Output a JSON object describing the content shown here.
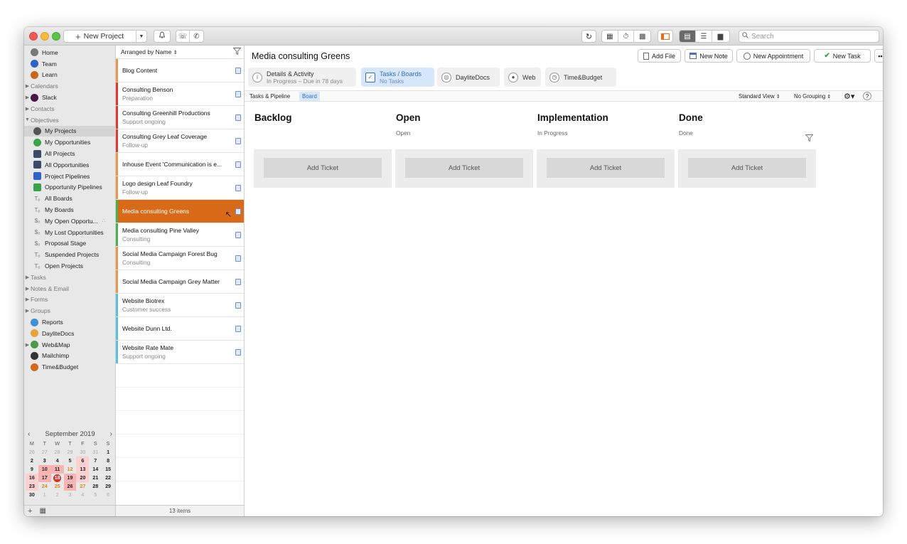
{
  "toolbar": {
    "new_project_label": "New Project",
    "search_placeholder": "Search"
  },
  "sidebar": {
    "items": [
      {
        "label": "Home",
        "icon": "house-icon",
        "color": "#777777"
      },
      {
        "label": "Team",
        "icon": "team-icon",
        "color": "#2d63c7"
      },
      {
        "label": "Learn",
        "icon": "books-icon",
        "color": "#c6671c"
      },
      {
        "label": "Calendars",
        "section": true
      },
      {
        "label": "Slack",
        "icon": "slack-icon",
        "color": "#4a154b",
        "expandable": true
      },
      {
        "label": "Contacts",
        "section": true
      },
      {
        "label": "Objectives",
        "section": true,
        "expanded": true
      },
      {
        "label": "My Projects",
        "icon": "pin-icon",
        "color": "#555555",
        "selected": true
      },
      {
        "label": "My Opportunities",
        "icon": "dollar-icon",
        "color": "#3aa24a"
      },
      {
        "label": "All Projects",
        "icon": "projects-icon",
        "color": "#3c4a6a"
      },
      {
        "label": "All Opportunities",
        "icon": "opportunities-icon",
        "color": "#3c4a6a"
      },
      {
        "label": "Project Pipelines",
        "icon": "pipeline-icon",
        "color": "#2d63c7"
      },
      {
        "label": "Opportunity Pipelines",
        "icon": "pipeline-icon",
        "color": "#3aa24a"
      },
      {
        "label": "All Boards",
        "icon": "board-icon",
        "color": "#888888"
      },
      {
        "label": "My Boards",
        "icon": "board-icon",
        "color": "#888888"
      },
      {
        "label": "My Open Opportu...",
        "icon": "filter-dollar-icon",
        "color": "#888888",
        "shared": true
      },
      {
        "label": "My Lost Opportunities",
        "icon": "filter-dollar-icon",
        "color": "#888888"
      },
      {
        "label": "Proposal Stage",
        "icon": "filter-dollar-icon",
        "color": "#888888"
      },
      {
        "label": "Suspended Projects",
        "icon": "board-icon",
        "color": "#888888"
      },
      {
        "label": "Open Projects",
        "icon": "board-icon",
        "color": "#888888"
      },
      {
        "label": "Tasks",
        "section": true
      },
      {
        "label": "Notes & Email",
        "section": true
      },
      {
        "label": "Forms",
        "section": true
      },
      {
        "label": "Groups",
        "section": true
      },
      {
        "label": "Reports",
        "icon": "reports-icon",
        "color": "#3f8fd6"
      },
      {
        "label": "DayliteDocs",
        "icon": "dayliteDocs-icon",
        "color": "#e8a33a"
      },
      {
        "label": "Web&Map",
        "icon": "globe-icon",
        "color": "#4a9a4a",
        "expandable": true
      },
      {
        "label": "Mailchimp",
        "icon": "mailchimp-icon",
        "color": "#333333"
      },
      {
        "label": "Time&Budget",
        "icon": "time-budget-icon",
        "color": "#d2691e"
      }
    ]
  },
  "calendar": {
    "month": "September 2019",
    "dow": [
      "M",
      "T",
      "W",
      "T",
      "F",
      "S",
      "S"
    ],
    "days": [
      {
        "d": "26",
        "c": "dim"
      },
      {
        "d": "27",
        "c": "dim"
      },
      {
        "d": "28",
        "c": "dim"
      },
      {
        "d": "29",
        "c": "dim"
      },
      {
        "d": "30",
        "c": "dim"
      },
      {
        "d": "31",
        "c": "dim"
      },
      {
        "d": "1",
        "c": ""
      },
      {
        "d": "2",
        "c": ""
      },
      {
        "d": "3",
        "c": ""
      },
      {
        "d": "4",
        "c": ""
      },
      {
        "d": "5",
        "c": ""
      },
      {
        "d": "6",
        "c": "r1"
      },
      {
        "d": "7",
        "c": ""
      },
      {
        "d": "8",
        "c": ""
      },
      {
        "d": "9",
        "c": ""
      },
      {
        "d": "10",
        "c": "r2"
      },
      {
        "d": "11",
        "c": "r2"
      },
      {
        "d": "12",
        "c": "or"
      },
      {
        "d": "13",
        "c": "r1"
      },
      {
        "d": "14",
        "c": ""
      },
      {
        "d": "15",
        "c": ""
      },
      {
        "d": "16",
        "c": "r1"
      },
      {
        "d": "17",
        "c": "r2"
      },
      {
        "d": "18",
        "c": "today"
      },
      {
        "d": "19",
        "c": "r2"
      },
      {
        "d": "20",
        "c": "r1"
      },
      {
        "d": "21",
        "c": ""
      },
      {
        "d": "22",
        "c": ""
      },
      {
        "d": "23",
        "c": "r1"
      },
      {
        "d": "24",
        "c": "or"
      },
      {
        "d": "25",
        "c": "or"
      },
      {
        "d": "26",
        "c": "r2"
      },
      {
        "d": "27",
        "c": "or"
      },
      {
        "d": "28",
        "c": ""
      },
      {
        "d": "29",
        "c": ""
      },
      {
        "d": "30",
        "c": ""
      },
      {
        "d": "1",
        "c": "dim"
      },
      {
        "d": "2",
        "c": "dim"
      },
      {
        "d": "3",
        "c": "dim"
      },
      {
        "d": "4",
        "c": "dim"
      },
      {
        "d": "5",
        "c": "dim"
      },
      {
        "d": "6",
        "c": "dim"
      }
    ]
  },
  "list": {
    "sort_label": "Arranged by Name",
    "count": "13 items",
    "items": [
      {
        "title": "Blog Content",
        "subtitle": "",
        "color": "#e8974a"
      },
      {
        "title": "Consulting Benson",
        "subtitle": "Preparation",
        "color": "#d93a32"
      },
      {
        "title": "Consulting Greenhill Productions",
        "subtitle": "Support ongoing",
        "color": "#d93a32"
      },
      {
        "title": "Consulting Grey Leaf Coverage",
        "subtitle": "Follow-up",
        "color": "#d93a32"
      },
      {
        "title": "Inhouse Event 'Communication is e...",
        "subtitle": "",
        "color": "#e8974a"
      },
      {
        "title": "Logo design Leaf Foundry",
        "subtitle": "Follow-up",
        "color": "#e8974a"
      },
      {
        "title": "Media consulting Greens",
        "subtitle": "",
        "color": "#4caf50",
        "selected": true
      },
      {
        "title": "Media consulting Pine Valley",
        "subtitle": "Consulting",
        "color": "#4caf50"
      },
      {
        "title": "Social Media Campaign Forest Bug",
        "subtitle": "Consulting",
        "color": "#e8974a"
      },
      {
        "title": "Social Media Campaign Grey Matter",
        "subtitle": "",
        "color": "#e8974a"
      },
      {
        "title": "Website Biotrex",
        "subtitle": "Customer success",
        "color": "#5bc0de"
      },
      {
        "title": "Website Dunn Ltd.",
        "subtitle": "",
        "color": "#5bc0de"
      },
      {
        "title": "Website Rate Mate",
        "subtitle": "Support ongoing",
        "color": "#5bc0de"
      }
    ]
  },
  "detail": {
    "title": "Media consulting Greens",
    "actions": {
      "add_file": "Add File",
      "new_note": "New Note",
      "new_appointment": "New Appointment",
      "new_task": "New Task"
    },
    "tabs": [
      {
        "label": "Details & Activity",
        "sub": "In Progress – Due in 78 days",
        "icon": "info-icon"
      },
      {
        "label": "Tasks / Boards",
        "sub": "No Tasks",
        "icon": "checkbox-icon",
        "active": true
      },
      {
        "label": "DayliteDocs",
        "sub": "",
        "icon": "dayliteDocs-icon"
      },
      {
        "label": "Web",
        "sub": "",
        "icon": "compass-icon"
      },
      {
        "label": "Time&Budget",
        "sub": "",
        "icon": "stopwatch-icon"
      }
    ],
    "subbar": {
      "pipeline_label": "Tasks & Pipeline",
      "board_label": "Board",
      "view_label": "Standard View",
      "grouping_label": "No Grouping",
      "help_label": "?"
    },
    "columns": [
      {
        "title": "Backlog",
        "subtitle": "",
        "add_label": "Add Ticket"
      },
      {
        "title": "Open",
        "subtitle": "Open",
        "add_label": "Add Ticket"
      },
      {
        "title": "Implementation",
        "subtitle": "In Progress",
        "add_label": "Add Ticket"
      },
      {
        "title": "Done",
        "subtitle": "Done",
        "add_label": "Add Ticket"
      }
    ]
  }
}
